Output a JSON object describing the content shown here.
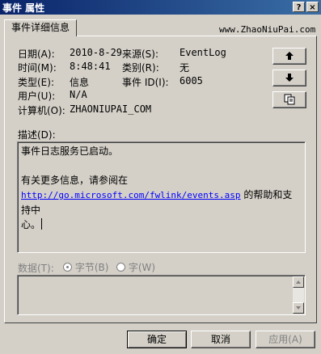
{
  "window": {
    "title": "事件 属性",
    "help_button": "?",
    "close_button": "×"
  },
  "tab": {
    "label": "事件详细信息"
  },
  "watermark": "www.ZhaoNiuPai.com",
  "fields": {
    "date_label": "日期(A):",
    "date_value": "2010-8-29",
    "source_label": "来源(S):",
    "source_value": "EventLog",
    "time_label": "时间(M):",
    "time_value": "8:48:41",
    "category_label": "类别(R):",
    "category_value": "无",
    "type_label": "类型(E):",
    "type_value": "信息",
    "event_id_label": "事件 ID(I):",
    "event_id_value": "6005",
    "user_label": "用户(U):",
    "user_value": "N/A",
    "computer_label": "计算机(O):",
    "computer_value": "ZHAONIUPAI_COM"
  },
  "nav_buttons": {
    "up_icon": "arrow-up-icon",
    "down_icon": "arrow-down-icon",
    "copy_icon": "copy-icon"
  },
  "description": {
    "label": "描述(D):",
    "line1": "事件日志服务已启动。",
    "line2": "有关更多信息，请参阅在",
    "link": "http://go.microsoft.com/fwlink/events.asp",
    "line3_suffix": " 的帮助和支持中",
    "line4": "心。"
  },
  "data_section": {
    "label": "数据(T):",
    "bytes_option": "字节(B)",
    "words_option": "字(W)"
  },
  "footer": {
    "ok_label": "确定",
    "cancel_label": "取消",
    "apply_label": "应用(A)"
  },
  "colors": {
    "face": "#d4d0c8",
    "titlebar_start": "#0a246a",
    "titlebar_end": "#3a6ea5",
    "link": "#0000ff"
  }
}
